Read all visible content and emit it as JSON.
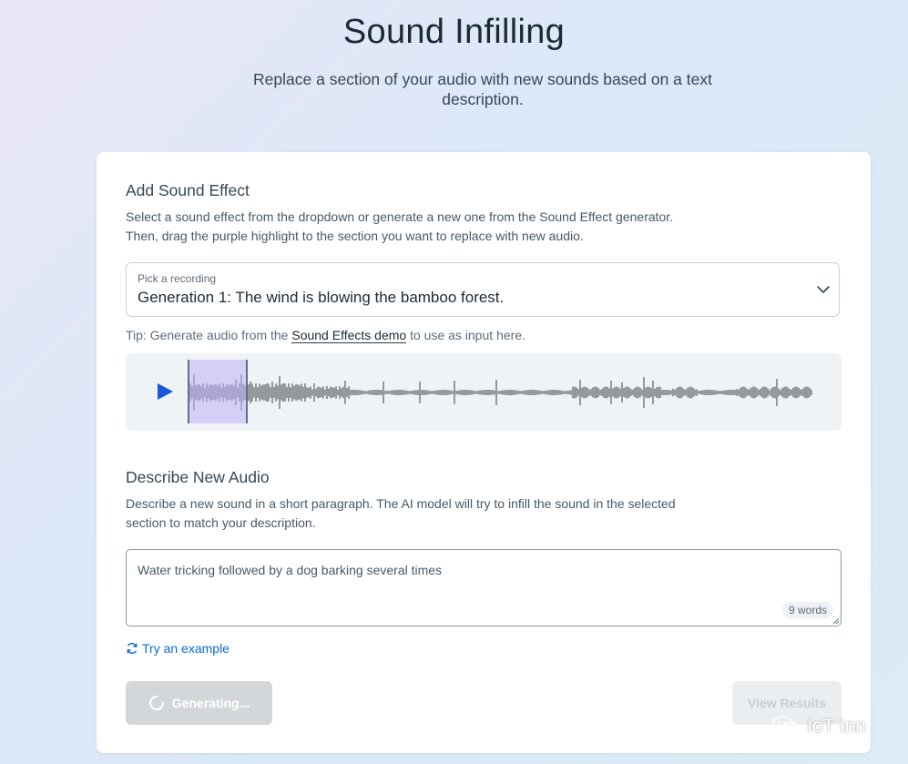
{
  "header": {
    "title": "Sound Infilling",
    "subtitle": "Replace a section of your audio with new sounds based on a text description."
  },
  "sound_effect": {
    "title": "Add Sound Effect",
    "description": "Select a sound effect from the dropdown or generate a new one from the Sound Effect generator. Then, drag the purple highlight to the section you want to replace with new audio.",
    "dropdown_label": "Pick a recording",
    "dropdown_value": "Generation 1: The wind is blowing the bamboo forest.",
    "tip_prefix": "Tip: Generate audio from the",
    "tip_link": "Sound Effects demo",
    "tip_suffix": "to use as input here.",
    "colors": {
      "selection": "#bcb0f8",
      "play": "#1a56db",
      "waveform": "#3a3f45"
    }
  },
  "new_audio": {
    "title": "Describe New Audio",
    "description": "Describe a new sound in a short paragraph. The AI model will try to infill the sound in the selected section to match your description.",
    "input_value": "Water tricking followed by a dog barking several times",
    "word_count": "9 words",
    "try_example": "Try an example"
  },
  "actions": {
    "generate_label": "Generating...",
    "view_results_label": "View Results"
  },
  "watermark": {
    "text": "IoT Inn"
  },
  "icons": {
    "chevron": "chevron-down-icon",
    "play": "play-icon",
    "refresh": "refresh-icon",
    "spinner": "spinner-icon",
    "wechat": "wechat-icon"
  }
}
